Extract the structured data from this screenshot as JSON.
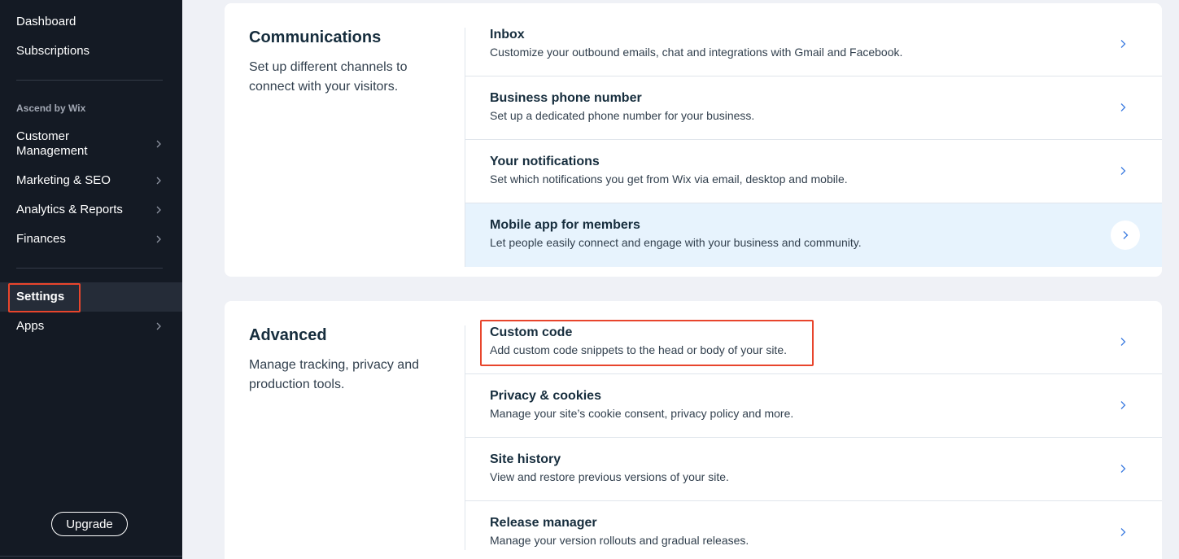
{
  "sidebar": {
    "top_items": [
      {
        "label": "Dashboard",
        "has_chevron": false
      },
      {
        "label": "Subscriptions",
        "has_chevron": false
      }
    ],
    "section_label": "Ascend by Wix",
    "mid_items": [
      {
        "label": "Customer\nManagement",
        "has_chevron": true
      },
      {
        "label": "Marketing & SEO",
        "has_chevron": true
      },
      {
        "label": "Analytics & Reports",
        "has_chevron": true
      },
      {
        "label": "Finances",
        "has_chevron": true
      }
    ],
    "bottom_items": [
      {
        "label": "Settings",
        "has_chevron": false,
        "selected": true
      },
      {
        "label": "Apps",
        "has_chevron": true
      }
    ],
    "upgrade_label": "Upgrade"
  },
  "communications": {
    "title": "Communications",
    "description": "Set up different channels to connect with your visitors.",
    "rows": [
      {
        "title": "Inbox",
        "subtitle": "Customize your outbound emails, chat and integrations with Gmail and Facebook."
      },
      {
        "title": "Business phone number",
        "subtitle": "Set up a dedicated phone number for your business."
      },
      {
        "title": "Your notifications",
        "subtitle": "Set which notifications you get from Wix via email, desktop and mobile."
      },
      {
        "title": "Mobile app for members",
        "subtitle": "Let people easily connect and engage with your business and community."
      }
    ]
  },
  "advanced": {
    "title": "Advanced",
    "description": "Manage tracking, privacy and production tools.",
    "rows": [
      {
        "title": "Custom code",
        "subtitle": "Add custom code snippets to the head or body of your site."
      },
      {
        "title": "Privacy & cookies",
        "subtitle": "Manage your site’s cookie consent, privacy policy and more."
      },
      {
        "title": "Site history",
        "subtitle": "View and restore previous versions of your site."
      },
      {
        "title": "Release manager",
        "subtitle": "Manage your version rollouts and gradual releases."
      }
    ]
  },
  "colors": {
    "sidebar_bg": "#141a24",
    "page_bg": "#eff1f6",
    "accent_blue": "#3b7be0",
    "hover_row_bg": "#e7f3fd",
    "highlight_red": "#e8452c"
  }
}
